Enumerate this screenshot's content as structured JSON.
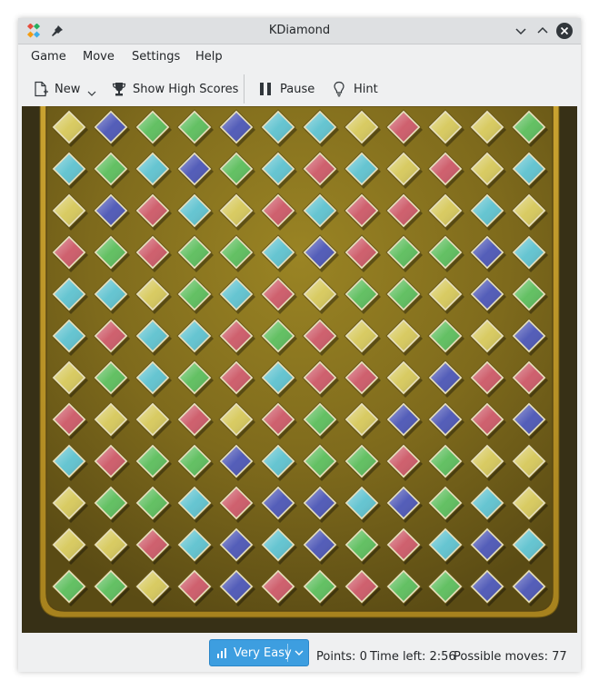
{
  "window": {
    "title": "KDiamond"
  },
  "menu": [
    "Game",
    "Move",
    "Settings",
    "Help"
  ],
  "toolbar": {
    "new_label": "New",
    "highscores_label": "Show High Scores",
    "pause_label": "Pause",
    "hint_label": "Hint"
  },
  "status": {
    "difficulty": "Very Easy",
    "points": "Points: 0",
    "time_left": "Time left: 2:56",
    "possible_moves": "Possible moves: 77"
  },
  "colors": {
    "Y": "#d6c85a",
    "B": "#4b55b5",
    "G": "#5bbd5b",
    "C": "#5ec2cf",
    "R": "#cc5866"
  },
  "icons": [
    "app-icon",
    "pin-icon",
    "minimize-icon",
    "maximize-icon",
    "close-icon",
    "new-game-icon",
    "trophy-icon",
    "pause-icon",
    "hint-bulb-icon",
    "difficulty-icon",
    "chevron-down-icon"
  ],
  "board": {
    "rows": [
      [
        "Y",
        "B",
        "G",
        "G",
        "B",
        "C",
        "C",
        "Y",
        "R",
        "Y",
        "Y",
        "G"
      ],
      [
        "C",
        "G",
        "C",
        "B",
        "G",
        "C",
        "R",
        "C",
        "Y",
        "R",
        "Y",
        "C"
      ],
      [
        "Y",
        "B",
        "R",
        "C",
        "Y",
        "R",
        "C",
        "R",
        "R",
        "Y",
        "C",
        "Y"
      ],
      [
        "R",
        "G",
        "R",
        "G",
        "G",
        "C",
        "B",
        "R",
        "G",
        "G",
        "B",
        "C"
      ],
      [
        "C",
        "C",
        "Y",
        "G",
        "C",
        "R",
        "Y",
        "G",
        "G",
        "Y",
        "B",
        "G"
      ],
      [
        "C",
        "R",
        "C",
        "C",
        "R",
        "G",
        "R",
        "Y",
        "Y",
        "G",
        "Y",
        "B"
      ],
      [
        "Y",
        "G",
        "C",
        "G",
        "R",
        "C",
        "R",
        "R",
        "Y",
        "B",
        "R",
        "R"
      ],
      [
        "R",
        "Y",
        "Y",
        "R",
        "Y",
        "R",
        "G",
        "Y",
        "B",
        "B",
        "R",
        "B"
      ],
      [
        "C",
        "R",
        "G",
        "G",
        "B",
        "C",
        "G",
        "G",
        "R",
        "G",
        "Y",
        "Y"
      ],
      [
        "Y",
        "G",
        "G",
        "C",
        "R",
        "B",
        "B",
        "C",
        "B",
        "G",
        "C",
        "Y"
      ],
      [
        "Y",
        "Y",
        "R",
        "C",
        "B",
        "C",
        "B",
        "G",
        "R",
        "C",
        "B",
        "C"
      ],
      [
        "G",
        "G",
        "Y",
        "R",
        "B",
        "R",
        "G",
        "R",
        "G",
        "G",
        "B",
        "B"
      ]
    ]
  }
}
